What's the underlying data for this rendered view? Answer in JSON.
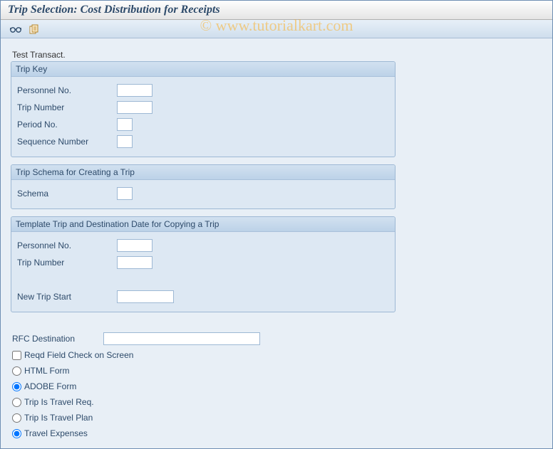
{
  "title": "Trip Selection: Cost Distribution for Receipts",
  "watermark": "© www.tutorialkart.com",
  "toolbar": {
    "glasses_icon": "glasses-icon",
    "copy_icon": "copy-icon"
  },
  "sections": {
    "test_transact": "Test Transact."
  },
  "groups": {
    "trip_key": {
      "title": "Trip Key",
      "fields": {
        "personnel_no": {
          "label": "Personnel No.",
          "value": ""
        },
        "trip_number": {
          "label": "Trip Number",
          "value": ""
        },
        "period_no": {
          "label": "Period No.",
          "value": ""
        },
        "sequence_no": {
          "label": "Sequence Number",
          "value": ""
        }
      }
    },
    "trip_schema": {
      "title": "Trip Schema for Creating a Trip",
      "fields": {
        "schema": {
          "label": "Schema",
          "value": ""
        }
      }
    },
    "template_trip": {
      "title": "Template Trip and Destination Date for Copying a Trip",
      "fields": {
        "personnel_no": {
          "label": "Personnel No.",
          "value": ""
        },
        "trip_number": {
          "label": "Trip Number",
          "value": ""
        },
        "new_trip_start": {
          "label": "New Trip Start",
          "value": ""
        }
      }
    }
  },
  "free": {
    "rfc_destination": {
      "label": "RFC Destination",
      "value": ""
    },
    "checkbox_reqd": {
      "label": "Reqd Field Check on Screen",
      "checked": false
    },
    "radio_form": {
      "selected": "adobe",
      "html": "HTML Form",
      "adobe": "ADOBE Form"
    },
    "radio_trip": {
      "selected": "expenses",
      "req": "Trip Is Travel Req.",
      "plan": "Trip Is Travel Plan",
      "exp": "Travel Expenses"
    }
  }
}
